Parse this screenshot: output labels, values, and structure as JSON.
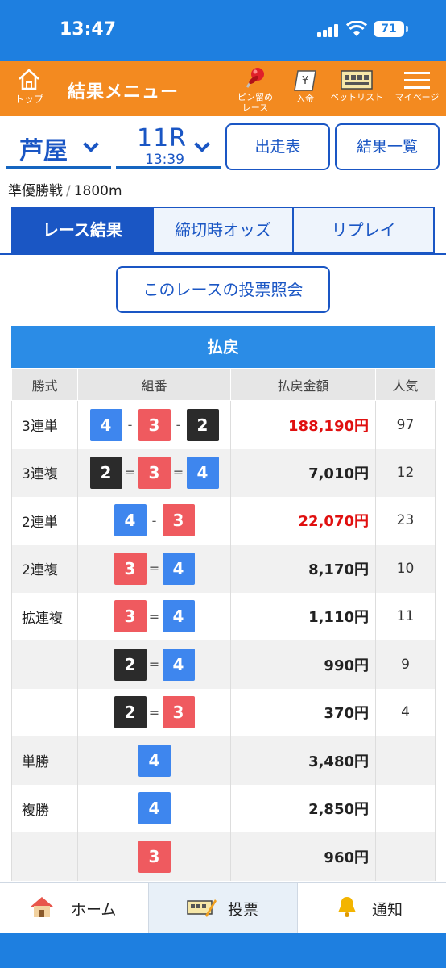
{
  "status": {
    "time": "13:47",
    "battery": "71"
  },
  "header": {
    "home_label": "トップ",
    "title": "結果メニュー",
    "pin_label_1": "ピン留め",
    "pin_label_2": "レース",
    "deposit_label": "入金",
    "betlist_label": "ベットリスト",
    "mypage_label": "マイページ"
  },
  "race_bar": {
    "venue": "芦屋",
    "race_no": "11R",
    "race_time": "13:39",
    "entries_button": "出走表",
    "results_list_button": "結果一覧"
  },
  "race_info": {
    "grade": "準優勝戦",
    "separator": "/",
    "distance": "1800m"
  },
  "tabs": [
    "レース結果",
    "締切時オッズ",
    "リプレイ"
  ],
  "vote_inquiry_button": "このレースの投票照会",
  "payout": {
    "title": "払戻",
    "headers": [
      "勝式",
      "組番",
      "払戻金額",
      "人気"
    ],
    "rows": [
      {
        "type": "3連単",
        "nums": [
          "4",
          "3",
          "2"
        ],
        "sep": "-",
        "amount": "188,190円",
        "pop": "97"
      },
      {
        "type": "3連複",
        "nums": [
          "2",
          "3",
          "4"
        ],
        "sep": "=",
        "amount": "7,010円",
        "pop": "12"
      },
      {
        "type": "2連単",
        "nums": [
          "4",
          "3"
        ],
        "sep": "-",
        "amount": "22,070円",
        "pop": "23"
      },
      {
        "type": "2連複",
        "nums": [
          "3",
          "4"
        ],
        "sep": "=",
        "amount": "8,170円",
        "pop": "10"
      },
      {
        "type": "拡連複",
        "nums": [
          "3",
          "4"
        ],
        "sep": "=",
        "amount": "1,110円",
        "pop": "11"
      },
      {
        "type": "",
        "nums": [
          "2",
          "4"
        ],
        "sep": "=",
        "amount": "990円",
        "pop": "9"
      },
      {
        "type": "",
        "nums": [
          "2",
          "3"
        ],
        "sep": "=",
        "amount": "370円",
        "pop": "4"
      },
      {
        "type": "単勝",
        "nums": [
          "4"
        ],
        "sep": "",
        "amount": "3,480円",
        "pop": ""
      },
      {
        "type": "複勝",
        "nums": [
          "4"
        ],
        "sep": "",
        "amount": "2,850円",
        "pop": ""
      },
      {
        "type": "",
        "nums": [
          "3"
        ],
        "sep": "",
        "amount": "960円",
        "pop": ""
      }
    ]
  },
  "bottom_nav": {
    "home": "ホーム",
    "vote": "投票",
    "notify": "通知"
  },
  "colors": {
    "orange": "#f38a20",
    "blue": "#1a56c4",
    "boat3": "#ef5a5f",
    "boat4": "#3e86ee",
    "boat2": "#2b2b2b",
    "high_payout": "#e01010"
  },
  "icons": [
    "home-icon",
    "pin-icon",
    "yen-ticket-icon",
    "betlist-icon",
    "menu-icon",
    "chevron-down-icon",
    "house-icon",
    "ticket-pencil-icon",
    "bell-icon"
  ]
}
